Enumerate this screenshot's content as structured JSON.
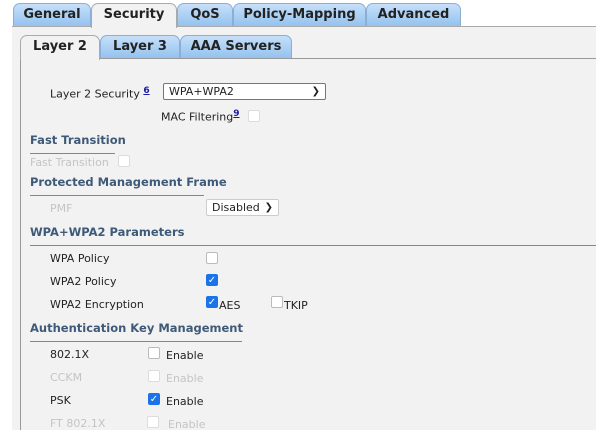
{
  "tabs": [
    "General",
    "Security",
    "QoS",
    "Policy-Mapping",
    "Advanced"
  ],
  "subtabs": [
    "Layer 2",
    "Layer 3",
    "AAA Servers"
  ],
  "layer2_security": {
    "label": "Layer 2 Security",
    "footnote": "6",
    "value": "WPA+WPA2"
  },
  "mac_filtering": {
    "label": "MAC Filtering",
    "footnote": "9",
    "checked": false
  },
  "fast_transition": {
    "heading": "Fast Transition",
    "label": "Fast Transition",
    "checked": false
  },
  "pmf": {
    "heading": "Protected Management Frame",
    "label": "PMF",
    "value": "Disabled"
  },
  "wpa": {
    "heading": "WPA+WPA2 Parameters",
    "wpa_policy": "WPA Policy",
    "wpa2_policy": "WPA2 Policy",
    "wpa2_encryption": "WPA2 Encryption",
    "aes": "AES",
    "tkip": "TKIP"
  },
  "akm": {
    "heading": "Authentication Key Management",
    "enable": "Enable",
    "rows": [
      "802.1X",
      "CCKM",
      "PSK",
      "FT 802.1X"
    ]
  }
}
